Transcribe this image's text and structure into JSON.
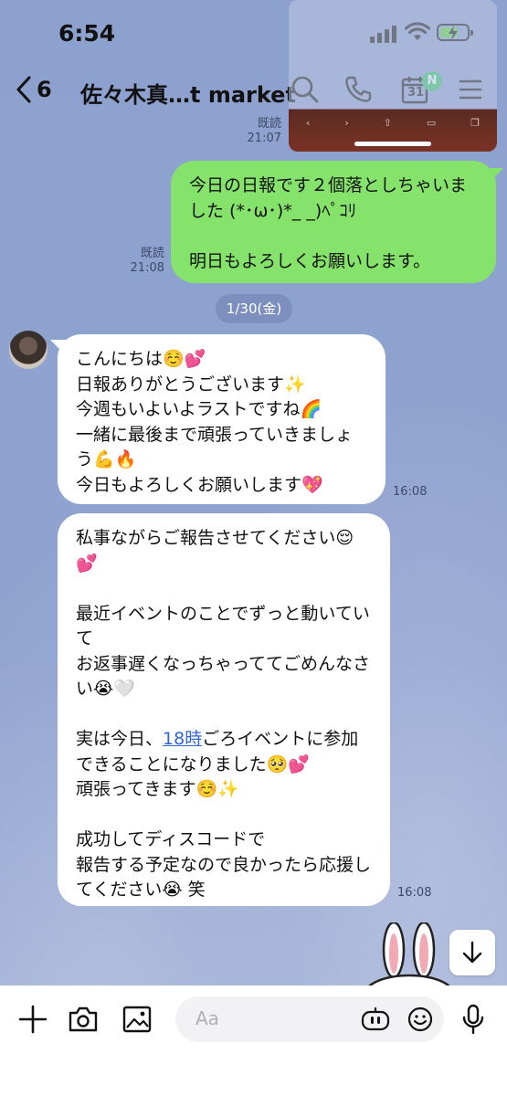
{
  "status_bar": {
    "time": "6:54"
  },
  "nav": {
    "back_count": "6",
    "title": "佐々木真…t market",
    "calendar_day": "31",
    "badge": "N"
  },
  "messages": {
    "sent": {
      "receipt_read_1": "既読",
      "receipt_time_1": "21:07",
      "receipt_read_2": "既読",
      "receipt_time_2": "21:08",
      "text": "今日の日報です２個落としちゃいました (*･ω･)*_ _)ﾍﾟｺﾘ\n\n明日もよろしくお願いします。"
    },
    "date_separator": "1/30(金)",
    "received_1": {
      "text": "こんにちは☺️💕\n日報ありがとうございます✨\n今週もいよいよラストですね🌈\n一緒に最後まで頑張っていきましょう💪🔥\n今日もよろしくお願いします💖",
      "time": "16:08"
    },
    "received_2": {
      "part1": "私事ながらご報告させてください😌💕\n\n最近イベントのことでずっと動いていて\nお返事遅くなっちゃっててごめんなさい😭🤍\n\n実は今日、",
      "link": "18時",
      "part2": "ごろイベントに参加できることになりました🥺💕\n頑張ってきます☺️✨\n\n成功してディスコードで\n報告する予定なので良かったら応援してください😭 笑",
      "time": "16:08"
    }
  },
  "input": {
    "placeholder": "Aa"
  },
  "colors": {
    "sent_bubble": "#85e26a",
    "received_bubble": "#ffffff",
    "background": "#8ca0cf",
    "badge": "#2fc46b"
  }
}
